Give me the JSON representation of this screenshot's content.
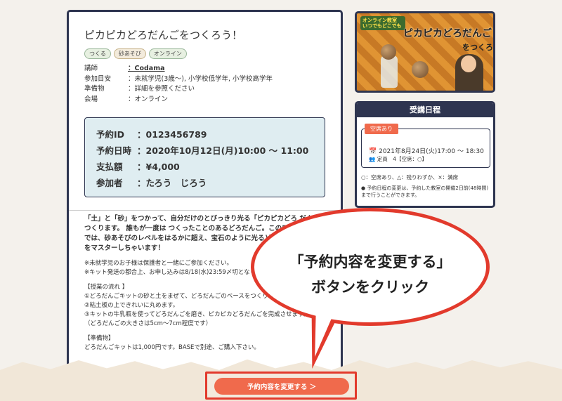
{
  "course": {
    "title": "ピカピカどろだんごをつくろう！",
    "tags": [
      "つくる",
      "砂あそび",
      "オンライン"
    ],
    "info": [
      {
        "key": "講師",
        "value": "：Codama"
      },
      {
        "key": "参加目安",
        "value": "：未就学児(3歳〜), 小学校低学年, 小学校高学年"
      },
      {
        "key": "準備物",
        "value": "：詳細を参照ください"
      },
      {
        "key": "会場",
        "value": "：オンライン"
      }
    ]
  },
  "booking": {
    "rows": [
      {
        "key": "予約ID",
        "value": "：0123456789"
      },
      {
        "key": "予約日時",
        "value": "：2020年10月12日(月)10:00 ～ 11:00"
      },
      {
        "key": "支払額",
        "value": "：¥4,000"
      },
      {
        "key": "参加者",
        "value": "：たろう　じろう"
      }
    ]
  },
  "description": {
    "lead": "「土」と「砂」をつかって、自分だけのとびっきり光る「ピカピカどろ だんご」をつくります。 誰もが一度は つくったことのあるどろだんご。このワークショ ップでは、砂あそびのレベルをはるかに超え、宝石のように光るどろだ んごのつくり方をマスターしちゃいます！",
    "notes": [
      "※未就学児のお子様は保護者と一緒にご参加ください。",
      "※キット発送の都合上、お申し込みは8/18(水)23:59〆切となります。"
    ],
    "flow_title": "【授業の流れ 】",
    "flow": [
      "①どろだんごキットの砂と土をまぜて、どろだんごのベースをつくります。",
      "②粘土板の上できれいに丸めます。",
      "③キットの牛乳瓶を使ってどろだんごを磨き、ピカピカどろだんごを完成させます。",
      "（どろだんごの大きさは5cm〜7cm程度です）"
    ],
    "prep_title": "【準備物】",
    "prep": "どろだんごキットは1,000円です。BASEで別途、ご購入下さい。"
  },
  "thumbnail": {
    "logo": "オンライン教室 いつでもどこでも",
    "title_line1": "ピカピカどろだんご",
    "title_line2": "をつくろう！"
  },
  "schedule": {
    "header": "受講日程",
    "slot_status": "空席あり",
    "slot_date": "2021年8月24日(火)17:00 ～ 18:30",
    "slot_capacity": "定員　4【空席：○】",
    "legend": "○：空席あり、△：残りわずか、×：満席",
    "note": "予約日程の変更は、予約した教室の開催2日前(48時間)まで行うことができます。"
  },
  "callout": {
    "line1": "「予約内容を変更する」",
    "line2": "ボタンをクリック"
  },
  "change_button": {
    "label": "予約内容を変更する ＞"
  },
  "colors": {
    "navy": "#2e3550",
    "accent": "#f06a4c",
    "highlight": "#e23a2c",
    "booking_bg": "#dfedf1"
  }
}
